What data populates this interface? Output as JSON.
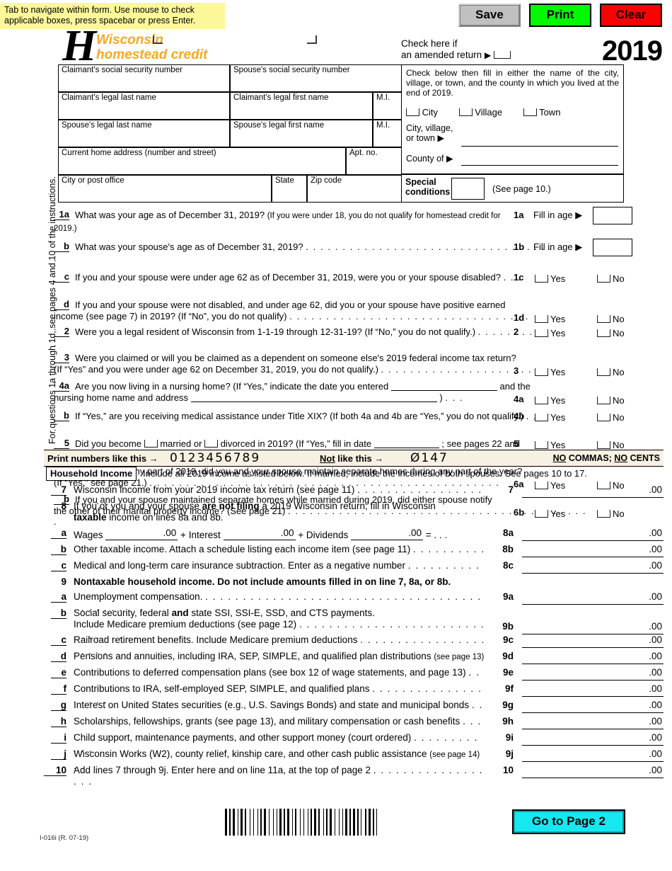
{
  "tip": "Tab to navigate within form. Use mouse to check applicable boxes, press spacebar or press Enter.",
  "buttons": {
    "save": "Save",
    "print": "Print",
    "clear": "Clear",
    "go_to_page_2": "Go to Page 2"
  },
  "masthead": {
    "letter": "H",
    "title_line1": "Wisconsin",
    "title_line2": "homestead credit",
    "amended_line1": "Check here if",
    "amended_line2": "an amended return",
    "year": "2019"
  },
  "identity": {
    "claimant_ssn": "Claimant's social security number",
    "spouse_ssn": "Spouse's social security number",
    "claimant_last": "Claimant's legal last name",
    "claimant_first": "Claimant's legal first name",
    "mi1": "M.I.",
    "spouse_last": "Spouse's legal last name",
    "spouse_first": "Spouse's legal first name",
    "mi2": "M.I.",
    "address": "Current home address (number and street)",
    "apt": "Apt. no.",
    "city_post": "City or post office",
    "state": "State",
    "zip": "Zip code"
  },
  "residence": {
    "instruction": "Check below then fill in either the name of the city, village, or town, and the county in which you lived at the end of 2019.",
    "city": "City",
    "village": "Village",
    "town": "Town",
    "cvt_label_1": "City, village,",
    "cvt_label_2": "or town",
    "county_label": "County of",
    "special_1": "Special",
    "special_2": "conditions",
    "special_see": "(See page 10.)"
  },
  "side_note": "For questions 1a through 1d, see pages 4 and 10 of the instructions.",
  "questions": [
    {
      "num": "1a",
      "text": "What was your age as of December 31, 2019?",
      "small": "(If you were under 18, you do not qualify for homestead credit for 2019.)",
      "ref": "1a",
      "type": "fill",
      "fill_label": "Fill in age"
    },
    {
      "num": "b",
      "text": "What was your spouse's age as of December 31, 2019?",
      "dots": true,
      "ref": "1b",
      "type": "fill",
      "fill_label": "Fill in age"
    },
    {
      "num": "c",
      "text": "If you and your spouse were under age 62 as of December 31, 2019, were you or your spouse disabled?",
      "dots": true,
      "ref": "1c",
      "type": "yesno"
    },
    {
      "num": "d",
      "text": "If you and your spouse were not disabled, and under age 62, did you or your spouse have positive earned",
      "text2": "income (see page 7) in 2019?  (If “No”, you do not qualify)",
      "dots": true,
      "ref": "1d",
      "type": "yesno"
    },
    {
      "num": "2",
      "text": "Were you a legal resident of Wisconsin from 1-1-19 through 12-31-19?  (If “No,” you do not qualify.)",
      "dots": true,
      "ref": "2",
      "type": "yesno"
    },
    {
      "num": "3",
      "text": "Were you claimed or will you be claimed as a dependent on someone else's 2019 federal income tax return?",
      "text2": "(If “Yes” and you were under age 62 on December 31, 2019, you do not qualify.)",
      "dots": true,
      "ref": "3",
      "type": "yesno"
    },
    {
      "num": "4a",
      "text": "Are you now living in a nursing home? (If “Yes,” indicate the date you entered",
      "text_after": "and the",
      "text2": "nursing home name and address",
      "text2_after": ")",
      "ref": "4a",
      "type": "yesno"
    },
    {
      "num": "b",
      "text": "If “Yes,” are you receiving medical assistance under Title XIX? (If both 4a and 4b are “Yes,” you do not qualify.)",
      "dots": true,
      "ref": "4b",
      "type": "yesno"
    },
    {
      "num": "5",
      "text": "Did you become",
      "text_mid1": "married  or",
      "text_mid2": "divorced in 2019? (If “Yes,” fill in date",
      "text_after": "; see pages 22 and 23.)",
      "ref": "5",
      "type": "yesno"
    },
    {
      "num": "6a",
      "text": "If married for any part of 2019, did you and your spouse maintain separate homes during any part of the year?",
      "text2": "(If “Yes,” see page 21.)",
      "dots": true,
      "ref": "6a",
      "type": "yesno"
    },
    {
      "num": "b",
      "text": "If you and your spouse maintained separate homes while married during 2019, did either spouse notify",
      "text2": "the other of their marital property income? (See page 21)",
      "dots": true,
      "ref": "6b",
      "type": "yesno"
    }
  ],
  "yes_label": "Yes",
  "no_label": "No",
  "band": {
    "print_like": "Print numbers like this →",
    "digits_good": "0123456789",
    "not_like_u": "Not",
    "not_like_rest": " like this →",
    "digits_bad": "Ø147",
    "no_commas_u1": "NO",
    "no_commas_mid": " COMMAS; ",
    "no_commas_u2": "NO",
    "no_commas_end": " CENTS"
  },
  "household": {
    "tag": "Household Income",
    "text": "Include all 2019 income as listed below.  If married, include the incomes of both spouses.  See pages 10 to 17."
  },
  "income_lines": [
    {
      "num": "7",
      "text": "Wisconsin income from your 2019 income tax return (see page 11)",
      "dots": true,
      "ref": "7",
      "cents": ".00",
      "value": ""
    },
    {
      "num": "8",
      "text": "If you or you and your spouse are not filing a 2019 Wisconsin return, fill in Wisconsin",
      "bold_part": "are not filing",
      "text2": "taxable income on lines 8a and 8b.",
      "bold_part2": "taxable",
      "type": "header"
    },
    {
      "num": "a",
      "type": "wages",
      "w_wages": "Wages",
      "w_plus1": "+",
      "w_interest": "Interest",
      "w_plus2": "+",
      "w_dividends": "Dividends",
      "w_eq": "= . . .",
      "ref": "8a",
      "cents": ".00",
      "value": ""
    },
    {
      "num": "b",
      "text": "Other taxable income.  Attach a schedule listing each income item (see page 11)",
      "dots": true,
      "ref": "8b",
      "cents": ".00",
      "value": ""
    },
    {
      "num": "c",
      "text": "Medical and long-term care insurance subtraction. Enter as a negative number",
      "dots": true,
      "ref": "8c",
      "cents": ".00",
      "value": ""
    },
    {
      "num": "9",
      "text": "Nontaxable household income.  Do not include amounts filled in on line 7, 8a, or 8b.",
      "type": "header_bold"
    },
    {
      "num": "a",
      "text": "Unemployment compensation.",
      "dots": true,
      "ref": "9a",
      "cents": ".00",
      "value": ""
    },
    {
      "num": "b",
      "text": "Social security, federal and state SSI, SSI-E, SSD, and CTS payments.",
      "bold_part": "and",
      "text2": "Include Medicare premium deductions (see page 12)",
      "dots": true,
      "ref": "9b",
      "cents": ".00",
      "value": ""
    },
    {
      "num": "c",
      "text": "Railroad retirement benefits. Include Medicare premium deductions",
      "dots": true,
      "ref": "9c",
      "cents": ".00",
      "value": ""
    },
    {
      "num": "d",
      "text": "Pensions and annuities, including IRA, SEP, SIMPLE, and qualified plan distributions",
      "small": "(see page 13)",
      "ref": "9d",
      "cents": ".00",
      "value": ""
    },
    {
      "num": "e",
      "text": "Contributions to deferred compensation plans (see box 12 of wage statements, and page 13)",
      "dots": true,
      "ref": "9e",
      "cents": ".00",
      "value": ""
    },
    {
      "num": "f",
      "text": "Contributions to IRA, self-employed SEP, SIMPLE, and qualified plans",
      "dots": true,
      "ref": "9f",
      "cents": ".00",
      "value": ""
    },
    {
      "num": "g",
      "text": "Interest on United States securities (e.g., U.S. Savings Bonds) and state and municipal bonds",
      "dots": true,
      "ref": "9g",
      "cents": ".00",
      "value": ""
    },
    {
      "num": "h",
      "text": "Scholarships, fellowships, grants (see page 13), and military compensation or cash benefits",
      "dots": true,
      "ref": "9h",
      "cents": ".00",
      "value": ""
    },
    {
      "num": "i",
      "text": "Child support, maintenance payments, and other support money (court ordered)",
      "dots": true,
      "ref": "9i",
      "cents": ".00",
      "value": ""
    },
    {
      "num": "j",
      "text": "Wisconsin Works (W2), county relief, kinship care, and other cash public assistance",
      "small": "(see page 14)",
      "dots": true,
      "ref": "9j",
      "cents": ".00",
      "value": ""
    },
    {
      "num": "10",
      "text": "Add lines 7 through 9j.  Enter here and on line 11a, at the top of page 2",
      "dots": true,
      "ref": "10",
      "cents": ".00",
      "value": ""
    }
  ],
  "footer": {
    "form_id": "I-016i (R. 07-19)"
  },
  "colors": {
    "tip_bg": "#fcf89a",
    "print_btn": "#00f800",
    "clear_btn": "#fb0000",
    "brand_orange": "#f7a920",
    "band_bg": "#f7f1e3",
    "goto_btn": "#16e8f2"
  }
}
